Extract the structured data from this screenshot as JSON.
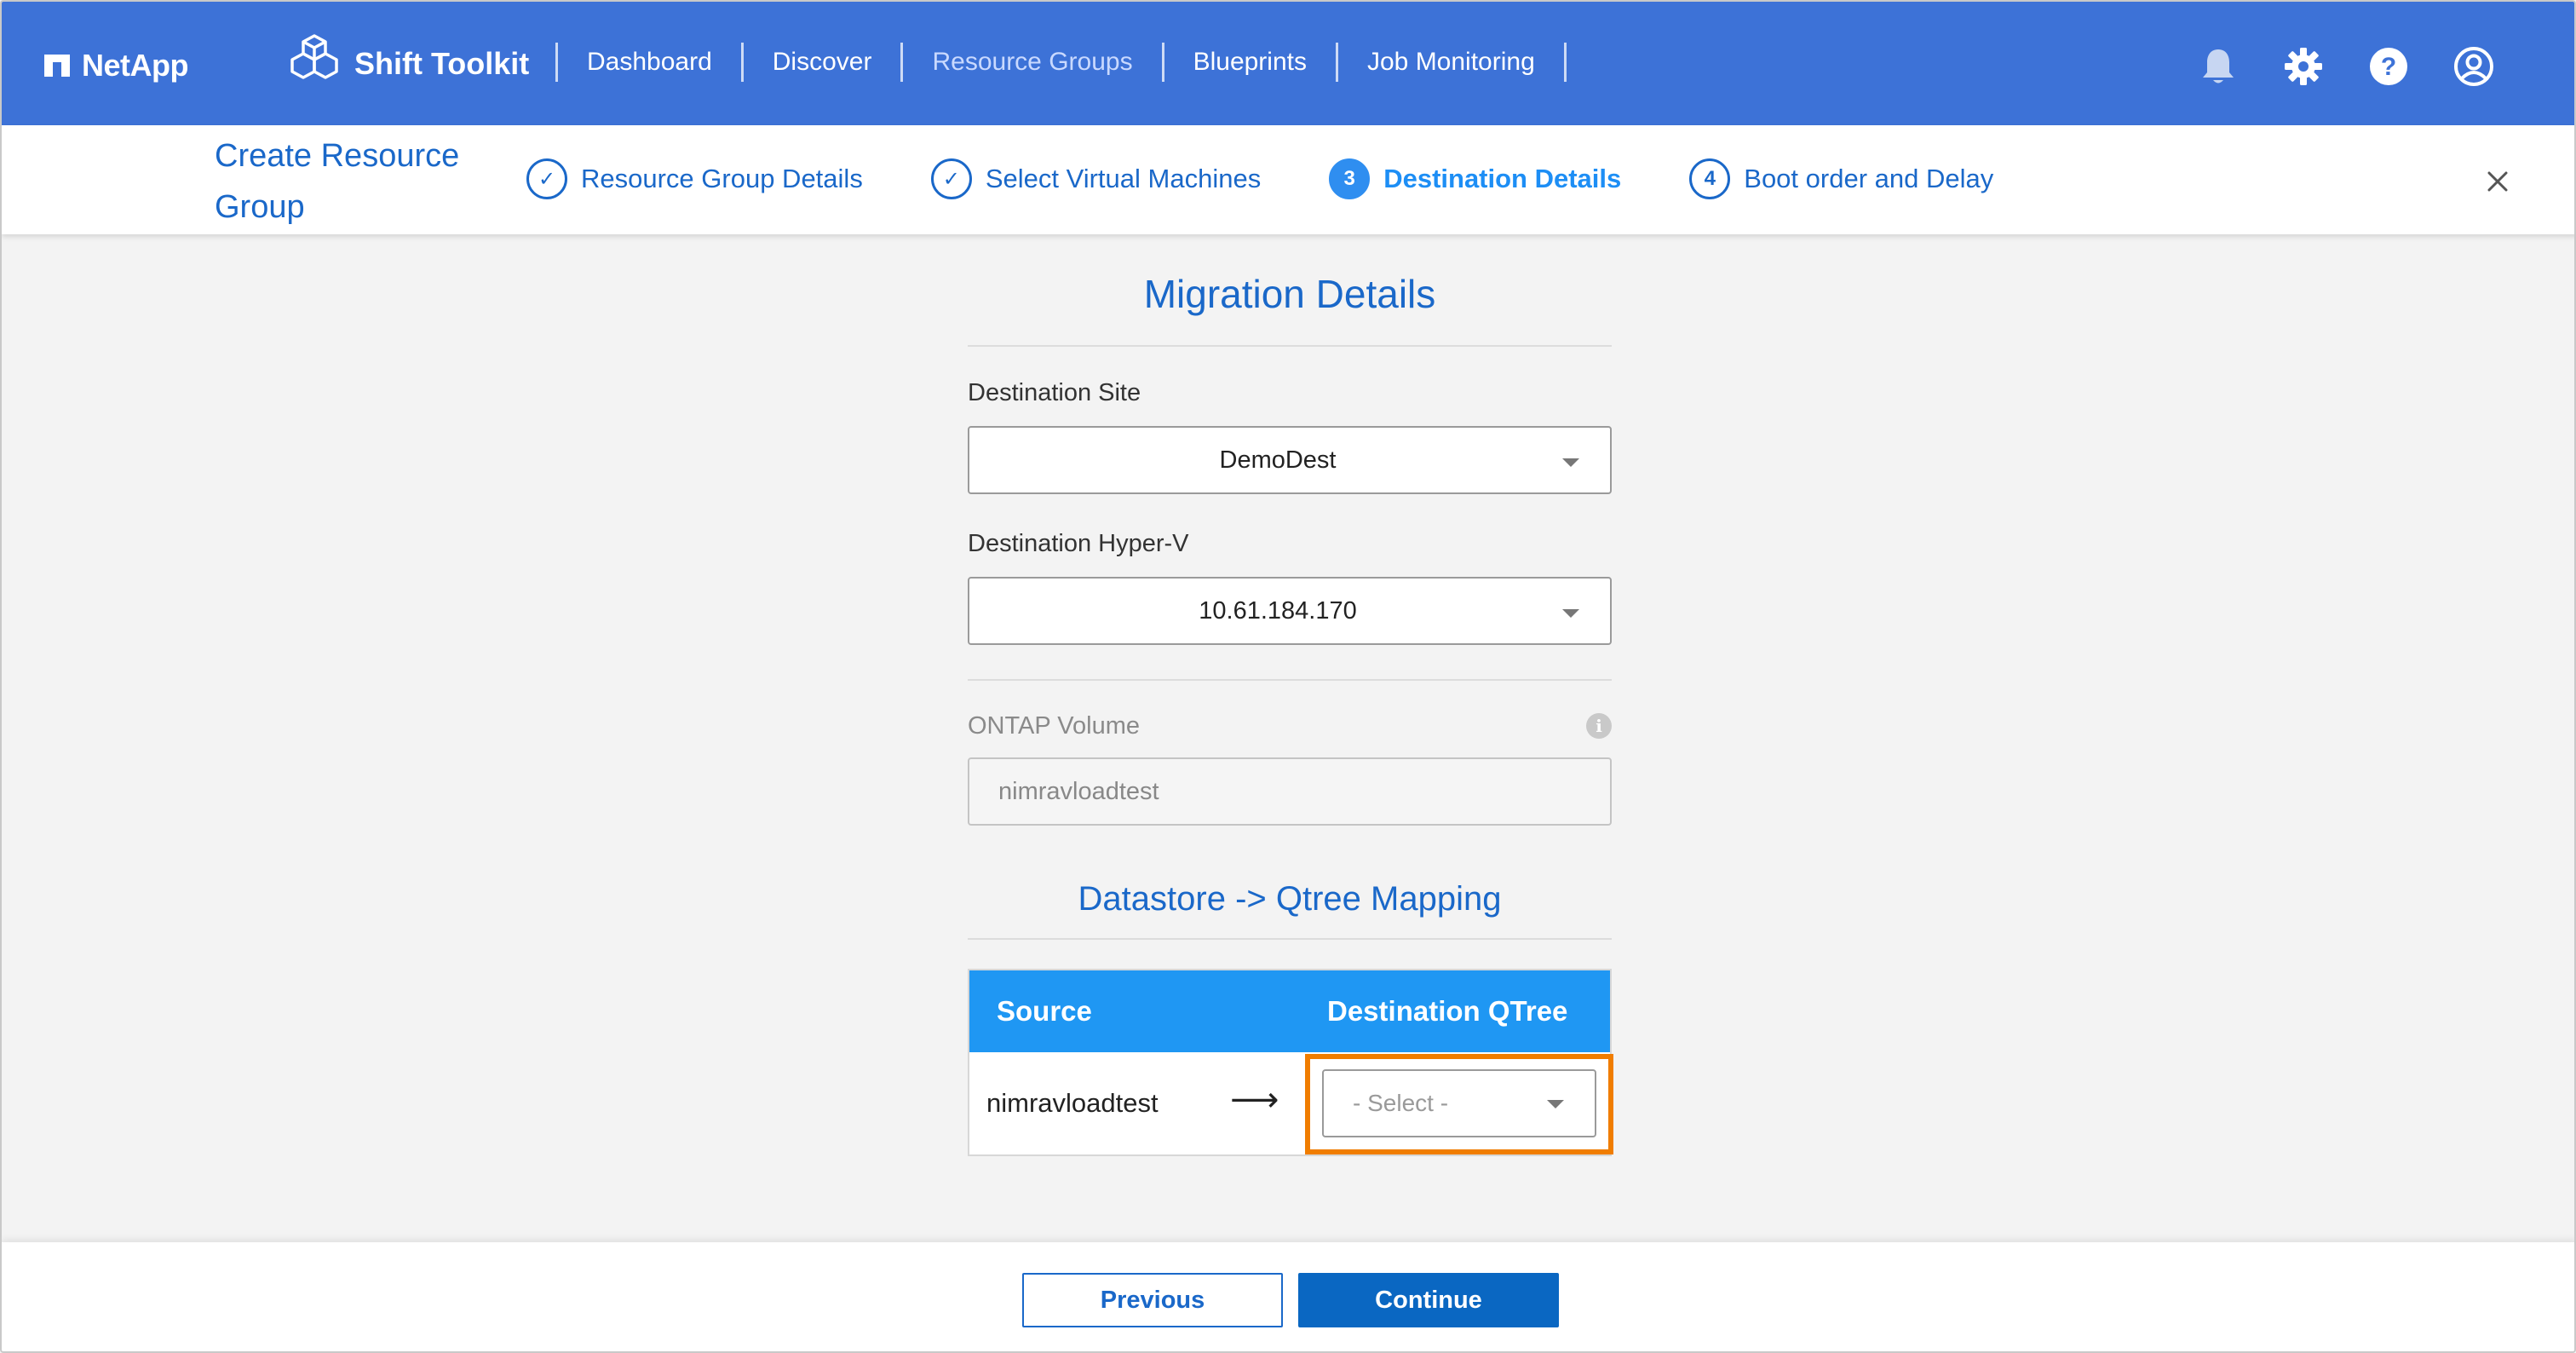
{
  "brand": {
    "name": "NetApp"
  },
  "product": {
    "name": "Shift Toolkit"
  },
  "nav": {
    "items": [
      {
        "label": "Dashboard",
        "active": false
      },
      {
        "label": "Discover",
        "active": false
      },
      {
        "label": "Resource Groups",
        "active": true
      },
      {
        "label": "Blueprints",
        "active": false
      },
      {
        "label": "Job Monitoring",
        "active": false
      }
    ]
  },
  "top_icons": [
    "bell-icon",
    "gear-icon",
    "help-icon",
    "user-account-icon"
  ],
  "wizard": {
    "title": "Create Resource Group",
    "steps": [
      {
        "marker": "✓",
        "label": "Resource Group Details",
        "state": "complete"
      },
      {
        "marker": "✓",
        "label": "Select Virtual Machines",
        "state": "complete"
      },
      {
        "marker": "3",
        "label": "Destination Details",
        "state": "current"
      },
      {
        "marker": "4",
        "label": "Boot order and Delay",
        "state": "upcoming"
      }
    ],
    "close_icon": "close-icon"
  },
  "form": {
    "migration_title": "Migration Details",
    "destination_site": {
      "label": "Destination Site",
      "value": "DemoDest"
    },
    "destination_hyperv": {
      "label": "Destination Hyper-V",
      "value": "10.61.184.170"
    },
    "ontap_volume": {
      "label": "ONTAP Volume",
      "value": "nimravloadtest",
      "info_icon": "i"
    },
    "mapping_title": "Datastore -> Qtree Mapping",
    "mapping_table": {
      "headers": {
        "source": "Source",
        "destination": "Destination QTree"
      },
      "rows": [
        {
          "source": "nimravloadtest",
          "arrow": "⟶",
          "destination_placeholder": "- Select -"
        }
      ]
    }
  },
  "footer": {
    "previous_label": "Previous",
    "continue_label": "Continue"
  },
  "colors": {
    "topbar": "#3d72d7",
    "accent": "#1a68c9",
    "table_header": "#1f97f3",
    "highlight": "#f07d00",
    "primary_button": "#0a67c2"
  }
}
